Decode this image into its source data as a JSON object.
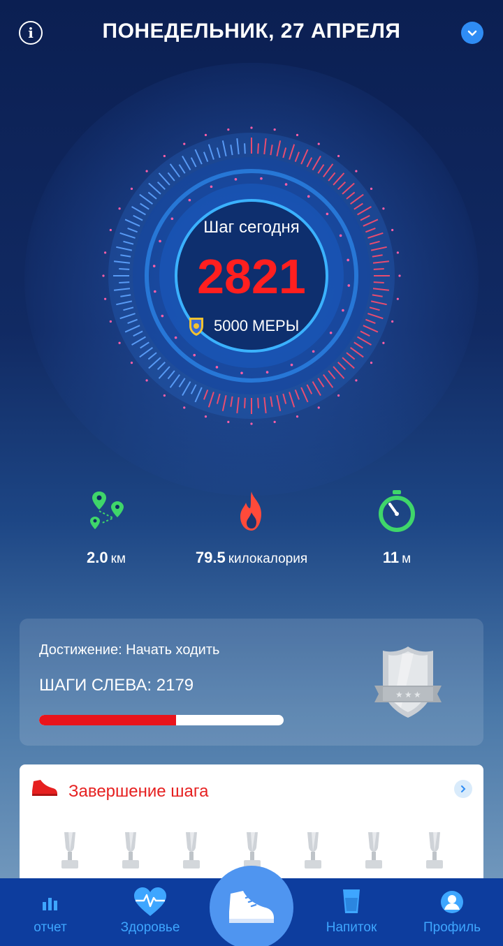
{
  "header": {
    "date": "ПОНЕДЕЛЬНИК, 27 АПРЕЛЯ",
    "info_icon": "info-icon",
    "dropdown_icon": "chevron-down-icon"
  },
  "steps": {
    "label": "Шаг сегодня",
    "count": "2821",
    "goal": "5000 МЕРЫ",
    "goal_icon": "badge-icon",
    "progress_fraction": 0.56
  },
  "stats": {
    "distance": {
      "value": "2.0",
      "unit": "км",
      "icon": "route-pins-icon"
    },
    "calories": {
      "value": "79.5",
      "unit": "килокалория",
      "icon": "flame-icon"
    },
    "time": {
      "value": "11",
      "unit": "м",
      "icon": "stopwatch-icon"
    }
  },
  "achievement": {
    "title": "Достижение: Начать ходить",
    "steps_left": "ШАГИ СЛЕВА:  2179",
    "progress_fraction": 0.56,
    "icon": "shield-badge-icon"
  },
  "step_completion": {
    "title": "Завершение шага",
    "icon": "sneaker-icon",
    "arrow_icon": "chevron-right-icon",
    "trophy_count": 7
  },
  "nav": {
    "report": "отчет",
    "health": "Здоровье",
    "drink": "Напиток",
    "profile": "Профиль"
  },
  "colors": {
    "accent_red": "#e8141c",
    "accent_blue": "#2f8cf4",
    "nav_bg": "#0d3d9e",
    "nav_text": "#3ea6ff",
    "stat_green": "#3fd66a",
    "flame_red": "#ff4a3a"
  }
}
